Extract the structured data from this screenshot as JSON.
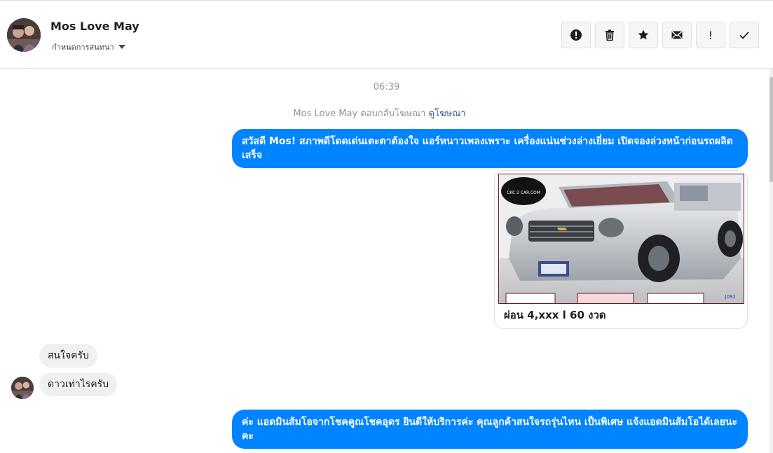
{
  "contact": {
    "name": "Mos Love May",
    "assign_label": "กำหนดการสนทนา"
  },
  "header_actions": [
    {
      "icon": "alert-circle-icon",
      "name": "spam"
    },
    {
      "icon": "trash-icon",
      "name": "delete"
    },
    {
      "icon": "star-icon",
      "name": "follow-up"
    },
    {
      "icon": "envelope-icon",
      "name": "mark-unread"
    },
    {
      "icon": "exclamation-icon",
      "name": "priority"
    },
    {
      "icon": "checkmark-icon",
      "name": "done"
    }
  ],
  "thread": {
    "timestamp": "06:39",
    "ad_note": {
      "text": "Mos Love May ตอบกลับโฆษณา",
      "link": "ดูโฆษณา"
    },
    "messages": [
      {
        "direction": "outgoing",
        "text": "สวัสดี Mos! สภาพดีโดดเด่นเตะตาต้องใจ แอร์หนาวเพลงเพราะ เครื่องแน่นช่วงล่างเยี่ยม เปิดจองล่วงหน้าก่อนรถผลิตเสร็จ"
      },
      {
        "direction": "outgoing",
        "type": "ad-card",
        "caption": "ผ่อน 4,xxx l 60 งวด",
        "watermark": "CKC 2 CAR.COM",
        "plate_code": "J092"
      },
      {
        "direction": "incoming",
        "text": "สนใจครับ"
      },
      {
        "direction": "incoming",
        "text": "ดาวเท่าไรครับ"
      },
      {
        "direction": "outgoing",
        "text": "ค่ะ แอดมินส้มโอจากโชคคูณโชคอุดร ยินดีให้บริการค่ะ   คุณลูกค้าสนใจรถรุ่นไหน เป็นพิเศษ แจ้งแอดมินส้มโอได้เลยนะคะ"
      }
    ]
  },
  "colors": {
    "outgoing_bubble": "#0084ff",
    "incoming_bubble": "#f1f0f0",
    "link": "#365899",
    "muted_text": "#90949c"
  }
}
